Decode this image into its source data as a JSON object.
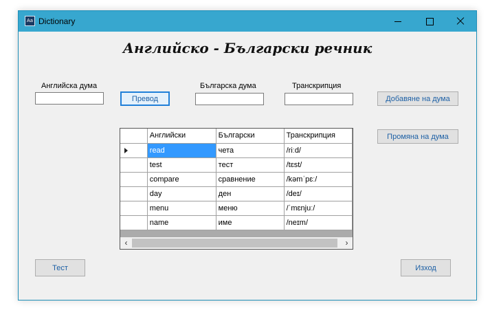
{
  "window": {
    "title": "Dictionary",
    "app_icon": "Aa"
  },
  "heading": "Английско - Български речник",
  "form": {
    "english_label": "Английска дума",
    "english_value": "",
    "translate_button": "Превод",
    "bulgarian_label": "Българска дума",
    "bulgarian_value": "",
    "transcription_label": "Транскрипция",
    "transcription_value": "",
    "add_button": "Добавяне на дума",
    "edit_button": "Промяна на дума"
  },
  "grid": {
    "columns": [
      "Английски",
      "Български",
      "Транскрипция"
    ],
    "rows": [
      {
        "english": "read",
        "bulgarian": "чета",
        "transcription": "/riːd/",
        "selected": true
      },
      {
        "english": "test",
        "bulgarian": "тест",
        "transcription": "/tɛst/"
      },
      {
        "english": "compare",
        "bulgarian": "сравнение",
        "transcription": "/kəmˈpɛː/"
      },
      {
        "english": "day",
        "bulgarian": "ден",
        "transcription": "/deɪ/"
      },
      {
        "english": "menu",
        "bulgarian": "меню",
        "transcription": "/ˈmɛnjuː/"
      },
      {
        "english": "name",
        "bulgarian": "име",
        "transcription": "/neɪm/"
      }
    ]
  },
  "footer": {
    "test_button": "Тест",
    "exit_button": "Изход"
  }
}
